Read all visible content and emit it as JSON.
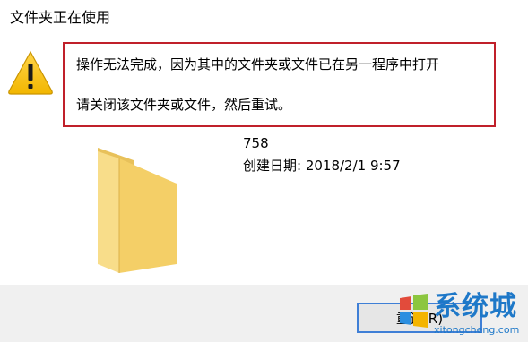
{
  "dialog": {
    "title": "文件夹正在使用",
    "message_line1": "操作无法完成，因为其中的文件夹或文件已在另一程序中打开",
    "message_line2": "请关闭该文件夹或文件，然后重试。",
    "icon": "warning-icon",
    "highlight_color": "#c0202a"
  },
  "file": {
    "icon": "folder-icon",
    "name": "758",
    "created": "创建日期: 2018/2/1 9:57"
  },
  "buttons": {
    "retry_label": "重试(R)"
  },
  "watermark": {
    "brand": "系统城",
    "url": "xitongcheng.com",
    "icon": "windows-logo-icon"
  }
}
